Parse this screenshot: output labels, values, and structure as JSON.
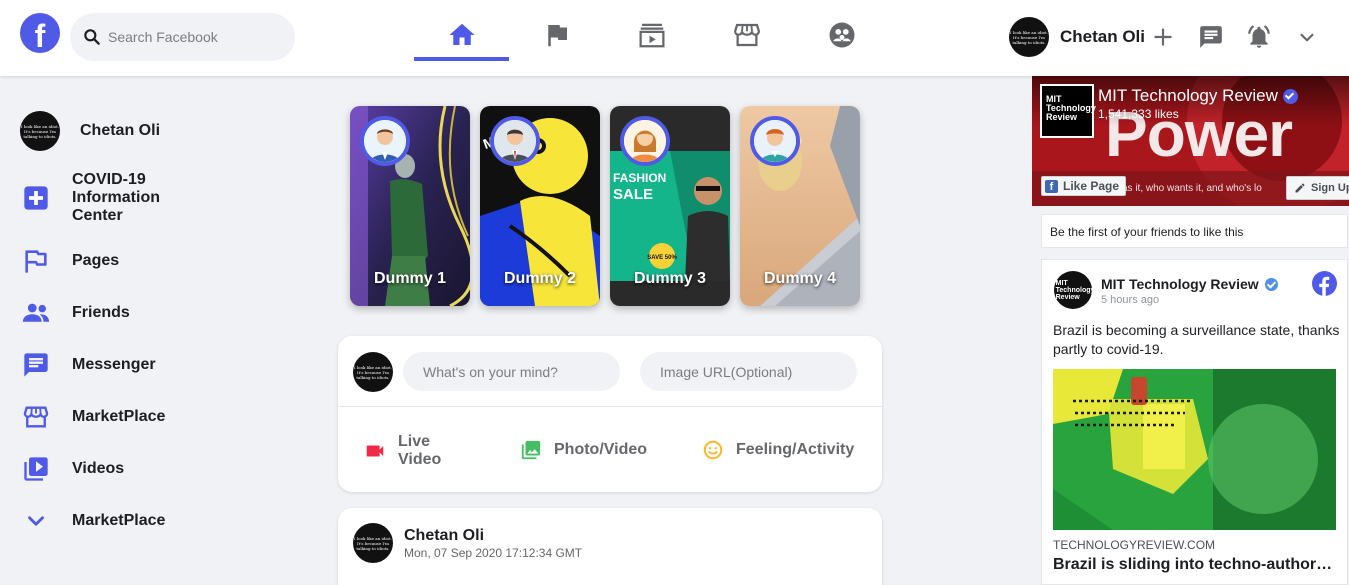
{
  "header": {
    "logo": "f",
    "search_placeholder": "Search Facebook",
    "user_name": "Chetan Oli",
    "avatar_text": "I look like an idiot. It's because I'm talking to idiots.",
    "nav_tabs": [
      "home-icon",
      "flag-icon",
      "watch-icon",
      "marketplace-icon",
      "groups-icon"
    ],
    "active_tab": "home-icon"
  },
  "sidebar": {
    "profile_name": "Chetan Oli",
    "items": [
      {
        "label": "COVID-19 Information Center",
        "icon": "plus-square-icon"
      },
      {
        "label": "Pages",
        "icon": "flag-icon"
      },
      {
        "label": "Friends",
        "icon": "people-icon"
      },
      {
        "label": "Messenger",
        "icon": "chat-icon"
      },
      {
        "label": "MarketPlace",
        "icon": "store-icon"
      },
      {
        "label": "Videos",
        "icon": "video-library-icon"
      },
      {
        "label": "MarketPlace",
        "icon": "chevron-down-icon"
      }
    ]
  },
  "stories": [
    {
      "name": "Dummy 1"
    },
    {
      "name": "Dummy 2"
    },
    {
      "name": "Dummy 3",
      "overlay_title_1": "FASHION",
      "overlay_title_2": "SALE",
      "overlay_badge": "SAVE 50%"
    },
    {
      "name": "Dummy 4"
    }
  ],
  "composer": {
    "mind_placeholder": "What's on your mind?",
    "image_placeholder": "Image URL(Optional)",
    "actions": [
      {
        "label": "Live Video",
        "icon": "video-camera-icon"
      },
      {
        "label": "Photo/Video",
        "icon": "photo-icon"
      },
      {
        "label": "Feeling/Activity",
        "icon": "smiley-icon"
      }
    ]
  },
  "post": {
    "author": "Chetan Oli",
    "timestamp": "Mon, 07 Sep 2020 17:12:34 GMT"
  },
  "right_panel": {
    "page_name": "MIT Technology Review",
    "likes": "1,541,333 likes",
    "banner_word": "Power",
    "banner_sub": "as it, who wants it, and who's lo",
    "like_page_label": "Like Page",
    "sign_up_label": "Sign Up",
    "friends_text": "Be the first of your friends to like this",
    "logo_text": "MIT Technology Review",
    "post_author": "MIT Technology Review",
    "post_time": "5 hours ago",
    "post_text": "Brazil is becoming a surveillance state, thanks partly to covid-19.",
    "link_domain": "TECHNOLOGYREVIEW.COM",
    "link_title": "Brazil is sliding into techno-authoritarianism"
  },
  "colors": {
    "accent": "#4f5ae6",
    "live_red": "#f02849",
    "photo_green": "#45bd62",
    "feeling_yellow": "#f7b928"
  }
}
